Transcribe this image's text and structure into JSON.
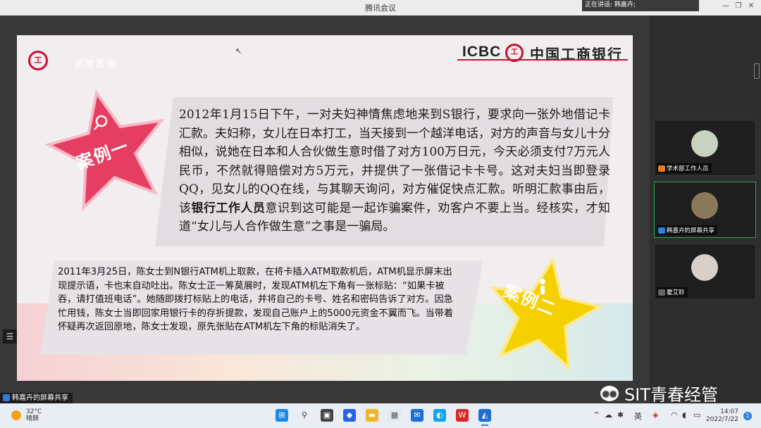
{
  "window": {
    "title": "腾讯会议",
    "speaking": "正在讲话: 韩嘉卉;",
    "controls": [
      "—",
      "□",
      "✕"
    ],
    "min_glyph": "—",
    "restore_glyph": "❐",
    "close_glyph": "✕"
  },
  "slide": {
    "section_title": "风险案例",
    "bank_en": "ICBC",
    "bank_logo_glyph": "工",
    "bank_cn": "中国工商银行",
    "case1": {
      "label": "案例一",
      "text_before": "2012年1月15日下午，一对夫妇神情焦虑地来到S银行，要求向一张外地借记卡汇款。夫妇称，女儿在日本打工，当天接到一个越洋电话，对方的声音与女儿十分相似，说她在日本和人合伙做生意时借了对方100万日元，今天必须支付7万元人民币，不然就得赔偿对方5万元，并提供了一张借记卡卡号。这对夫妇当即登录QQ，见女儿的QQ在线，与其聊天询问，对方催促快点汇款。听明汇款事由后，该",
      "text_bold": "银行工作人员",
      "text_after": "意识到这可能是一起诈骗案件，劝客户不要上当。经核实，才知道“女儿与人合作做生意”之事是一骗局。"
    },
    "case2": {
      "label": "案例二",
      "text": "2011年3月25日，陈女士到N银行ATM机上取款，在将卡插入ATM取款机后，ATM机显示屏末出现提示语，卡也末自动吐出。陈女士正一筹莫展时，发现ATM机左下角有一张标贴：“如果卡被吞，请打值班电话”。她随即拨打标贴上的电话，并将自己的卡号、姓名和密码告诉了对方。因急忙用钱，陈女士当即回家用银行卡的存折提款，发现自己账户上的5000元资金不翼而飞。当带着怀疑再次返回原地，陈女士发现，原先张贴在ATM机左下角的标贴消失了。"
    }
  },
  "share_label": "韩嘉卉的屏幕共享",
  "side_tool_glyph": "☰",
  "participants": [
    {
      "name": "学术部工作人员",
      "avatar_color": "#c8d2c0"
    },
    {
      "name": "韩嘉卉的屏幕共享",
      "avatar_color": "#8a7a5a"
    },
    {
      "name": "瞿艾聆",
      "avatar_color": "#d8cfc8"
    }
  ],
  "taskbar": {
    "temp": "32°C",
    "weather": "晴朗",
    "time": "14:07",
    "date": "2022/7/22",
    "notifications": "1",
    "tray_chevron": "^",
    "tray_ime": "英"
  },
  "watermark": "SIT青春经管",
  "colors": {
    "icbc_red": "#c8102e",
    "star1": "#e63e62",
    "star2": "#f5d000"
  }
}
